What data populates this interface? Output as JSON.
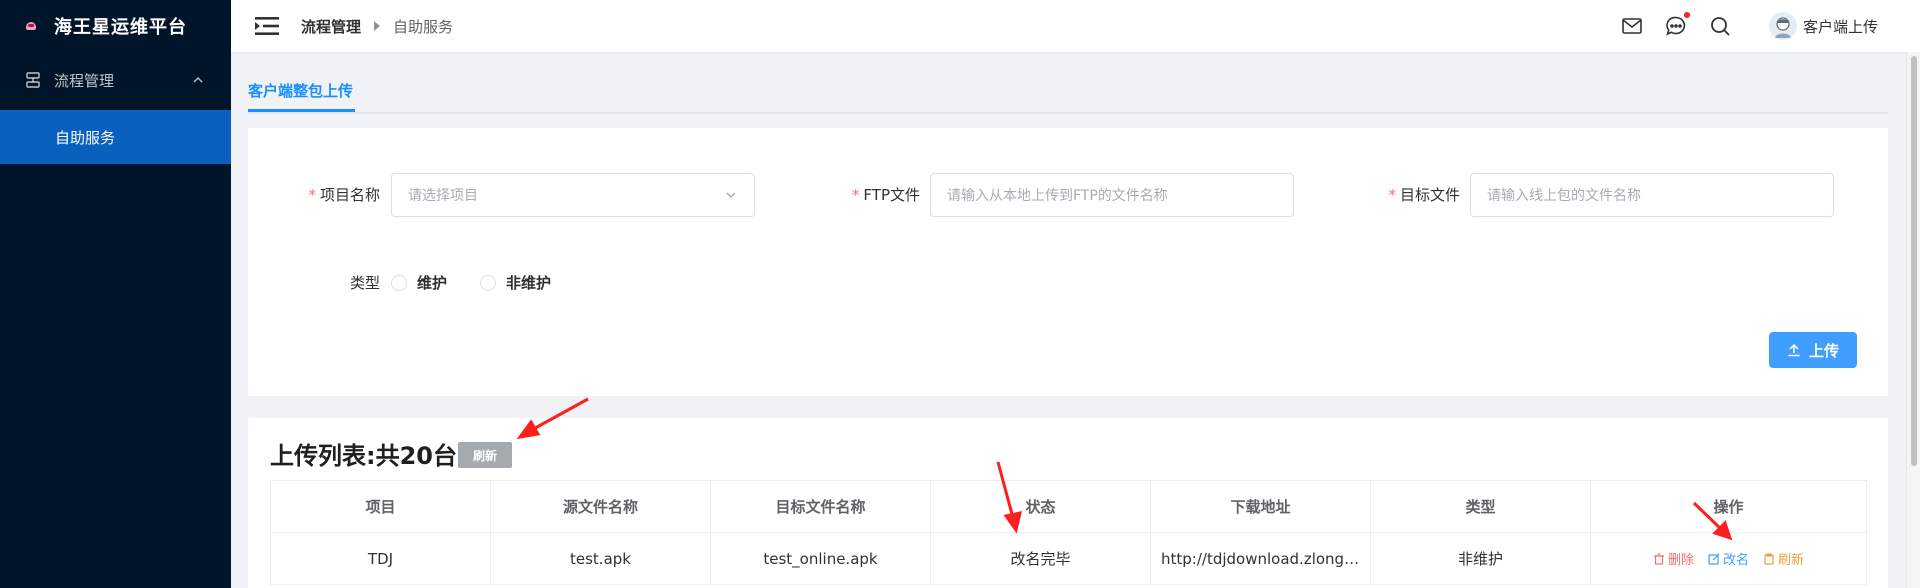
{
  "brand": {
    "title": "海王星运维平台"
  },
  "sidebar": {
    "group_label": "流程管理",
    "items": [
      {
        "label": "自助服务"
      }
    ]
  },
  "header": {
    "breadcrumb": [
      "流程管理",
      "自助服务"
    ],
    "username": "客户端上传"
  },
  "tabs": [
    {
      "label": "客户端整包上传"
    }
  ],
  "form": {
    "project": {
      "label": "项目名称",
      "placeholder": "请选择项目"
    },
    "ftp": {
      "label": "FTP文件",
      "placeholder": "请输入从本地上传到FTP的文件名称"
    },
    "target": {
      "label": "目标文件",
      "placeholder": "请输入线上包的文件名称"
    },
    "type": {
      "label": "类型",
      "options": [
        "维护",
        "非维护"
      ]
    },
    "upload_label": "上传"
  },
  "list": {
    "title": "上传列表:共20台",
    "refresh_label": "刷新",
    "columns": [
      "项目",
      "源文件名称",
      "目标文件名称",
      "状态",
      "下载地址",
      "类型",
      "操作"
    ],
    "rows": [
      {
        "project": "TDJ",
        "source": "test.apk",
        "target": "test_online.apk",
        "status": "改名完毕",
        "url": "http://tdjdownload.zlongame.com/test_online.apk",
        "type": "非维护",
        "ops": {
          "delete": "删除",
          "rename": "改名",
          "refresh": "刷新"
        }
      }
    ]
  },
  "colors": {
    "sidebar_bg": "#001529",
    "active_item": "#0960bd",
    "primary": "#409eff",
    "danger": "#f56c6c",
    "warning": "#e6a23c",
    "annotation": "#ff1e1e"
  }
}
